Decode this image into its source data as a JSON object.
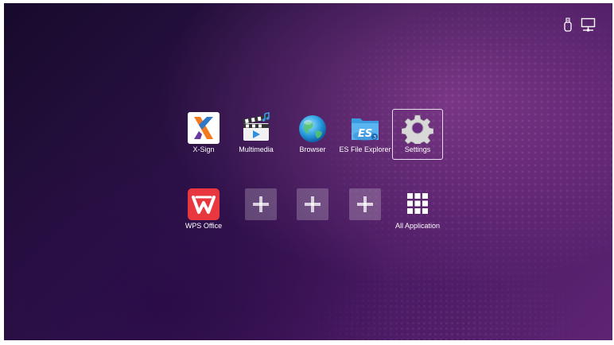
{
  "status_bar": {
    "icons": [
      "usb-icon",
      "network-icon"
    ]
  },
  "apps_row1": [
    {
      "label": "X-Sign",
      "icon": "x-sign-icon"
    },
    {
      "label": "Multimedia",
      "icon": "multimedia-icon"
    },
    {
      "label": "Browser",
      "icon": "browser-icon"
    },
    {
      "label": "ES File Explorer",
      "icon": "es-file-explorer-icon"
    },
    {
      "label": "Settings",
      "icon": "settings-icon",
      "selected": true
    }
  ],
  "apps_row2": [
    {
      "label": "WPS Office",
      "icon": "wps-office-icon"
    },
    {
      "label": "",
      "icon": "add-icon"
    },
    {
      "label": "",
      "icon": "add-icon"
    },
    {
      "label": "",
      "icon": "add-icon"
    },
    {
      "label": "All Application",
      "icon": "grid-icon"
    }
  ],
  "colors": {
    "background": "#2d1248",
    "accent": "#5e2474",
    "wps_red": "#e9373f",
    "xsign_orange": "#f47a20",
    "xsign_blue": "#2f78c7"
  }
}
